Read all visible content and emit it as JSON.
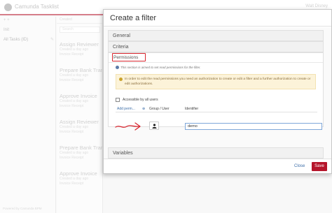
{
  "app": {
    "title": "Camunda Tasklist",
    "user_menu": "Walt Disney"
  },
  "filters": {
    "add_label": "+ + ",
    "items": [
      {
        "label": "Init"
      },
      {
        "label": "All Tasks (ID)"
      }
    ]
  },
  "tasklist": {
    "sort_label": "Created",
    "search_placeholder": "Search",
    "tasks": [
      {
        "name": "Assign Reviewer",
        "meta1": "Created a day ago",
        "meta2": "Invoice Receipt"
      },
      {
        "name": "Prepare Bank Transfer",
        "meta1": "Created a day ago",
        "meta2": "Invoice Receipt"
      },
      {
        "name": "Approve Invoice",
        "meta1": "Created a day ago",
        "meta2": "Invoice Receipt"
      },
      {
        "name": "Assign Reviewer",
        "meta1": "Created a day ago",
        "meta2": "Invoice Receipt"
      },
      {
        "name": "Prepare Bank Transfer",
        "meta1": "Created a day ago",
        "meta2": "Invoice Receipt"
      },
      {
        "name": "Approve Invoice",
        "meta1": "Created a day ago",
        "meta2": "Invoice Receipt"
      }
    ],
    "footer_note": "Powered by Camunda BPM"
  },
  "modal": {
    "title": "Create a filter",
    "panels": {
      "general": "General",
      "criteria": "Criteria",
      "permissions": "Permissions",
      "variables": "Variables"
    },
    "permissions": {
      "help": "This section is aimed to set read permissions for the filter.",
      "warning": "In order to edit the read permissions you need an authorization to create or edit a filter and a further authorization to create or edit authorizations.",
      "accessible_label": "Accessible by all users",
      "accessible_checked": false,
      "add_permission": "Add perm...",
      "col_group_user": "Group / User",
      "col_identifier": "Identifier",
      "identifier_value": "demo"
    },
    "footer": {
      "close_label": "Close",
      "save_label": "Save"
    }
  },
  "colors": {
    "accent": "#b5152b",
    "link": "#3d6ea8",
    "annotation": "#d8262f"
  }
}
